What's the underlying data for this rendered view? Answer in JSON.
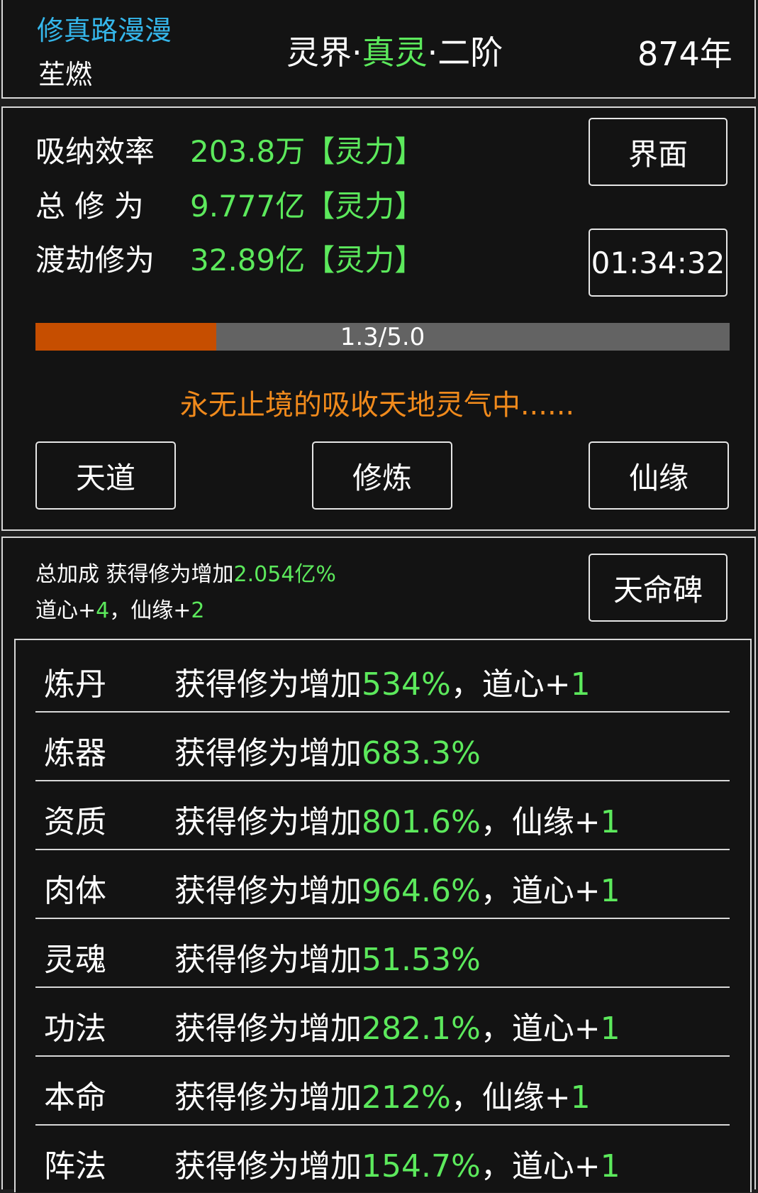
{
  "header": {
    "game_title": "修真路漫漫",
    "player_name": "苼燃",
    "realm_prefix": "灵界·",
    "realm_main": "真灵",
    "realm_suffix": "·二阶",
    "year": "874年"
  },
  "cultivation": {
    "stats": [
      {
        "label": "吸纳效率",
        "value": "203.8万【灵力】"
      },
      {
        "label": "总 修 为",
        "value": "9.777亿【灵力】"
      },
      {
        "label": "渡劫修为",
        "value": "32.89亿【灵力】"
      }
    ],
    "interface_button": "界面",
    "timer": "01:34:32",
    "progress": {
      "text": "1.3/5.0",
      "fraction": 0.26
    },
    "status_text": "永无止境的吸收天地灵气中......",
    "buttons": {
      "tiandao": "天道",
      "xiulian": "修炼",
      "xianyuan": "仙缘"
    }
  },
  "bonus": {
    "total_label": "总加成 获得修为增加",
    "total_value": "2.054亿%",
    "daoxin_label": "道心+",
    "daoxin_value": "4",
    "separator": "，",
    "xianyuan_label": "仙缘+",
    "xianyuan_value": "2",
    "tianming_button": "天命碑",
    "rows": [
      {
        "label": "炼丹",
        "prefix": "获得修为增加",
        "value": "534%",
        "extra_label": "，道心+",
        "extra_value": "1"
      },
      {
        "label": "炼器",
        "prefix": "获得修为增加",
        "value": "683.3%",
        "extra_label": "",
        "extra_value": ""
      },
      {
        "label": "资质",
        "prefix": "获得修为增加",
        "value": "801.6%",
        "extra_label": "，仙缘+",
        "extra_value": "1"
      },
      {
        "label": "肉体",
        "prefix": "获得修为增加",
        "value": "964.6%",
        "extra_label": "，道心+",
        "extra_value": "1"
      },
      {
        "label": "灵魂",
        "prefix": "获得修为增加",
        "value": "51.53%",
        "extra_label": "",
        "extra_value": ""
      },
      {
        "label": "功法",
        "prefix": "获得修为增加",
        "value": "282.1%",
        "extra_label": "，道心+",
        "extra_value": "1"
      },
      {
        "label": "本命",
        "prefix": "获得修为增加",
        "value": "212%",
        "extra_label": "，仙缘+",
        "extra_value": "1"
      },
      {
        "label": "阵法",
        "prefix": "获得修为增加",
        "value": "154.7%",
        "extra_label": "，道心+",
        "extra_value": "1"
      }
    ]
  }
}
